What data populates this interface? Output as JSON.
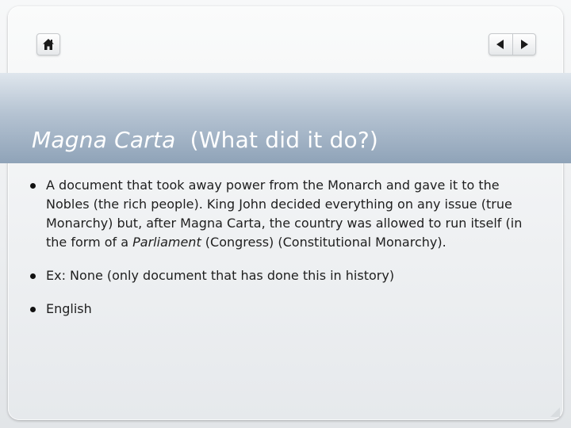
{
  "slide": {
    "title_italic": "Magna Carta",
    "title_rest": "  (What did it do?)",
    "bullets": [
      {
        "text_before": "A document that took away power from the Monarch and gave it to the Nobles (the rich people).  King John decided everything on any issue (true Monarchy) but, after Magna Carta, the country was allowed to run itself (in the form of a ",
        "text_italic": "Parliament",
        "text_after": " (Congress) (Constitutional Monarchy)."
      },
      {
        "text": "Ex: None (only document that has done this in history)"
      },
      {
        "text": "English"
      }
    ]
  },
  "nav": {
    "home_icon": "home-icon",
    "prev_icon": "triangle-left-icon",
    "next_icon": "triangle-right-icon"
  },
  "colors": {
    "title_band_top": "#dfe6ed",
    "title_band_bottom": "#8fa3b8",
    "title_text": "#ffffff",
    "body_text": "#1e1e1e"
  }
}
